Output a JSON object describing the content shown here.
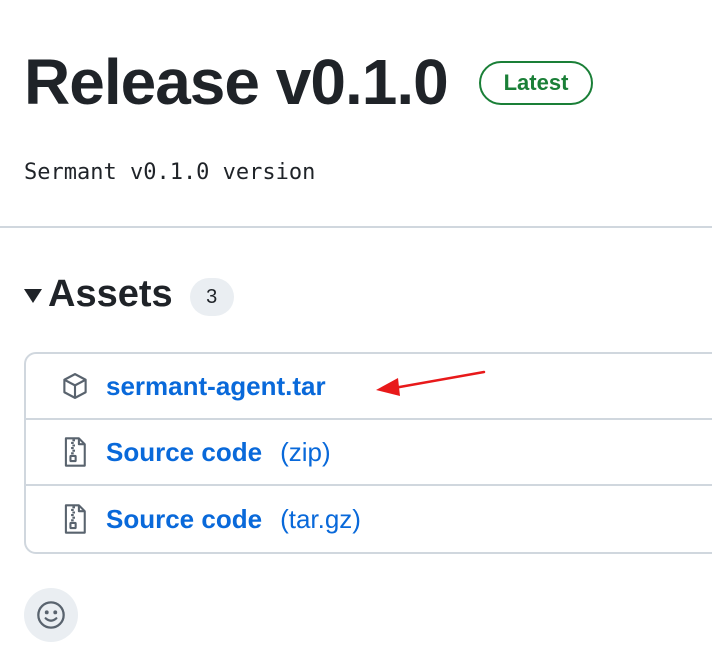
{
  "release": {
    "title": "Release v0.1.0",
    "badge": "Latest",
    "body": "Sermant v0.1.0 version"
  },
  "assets": {
    "title": "Assets",
    "count": "3",
    "items": [
      {
        "icon": "package-icon",
        "label": "sermant-agent.tar",
        "suffix": ""
      },
      {
        "icon": "file-zip-icon",
        "label": "Source code",
        "suffix": "(zip)"
      },
      {
        "icon": "file-zip-icon",
        "label": "Source code",
        "suffix": "(tar.gz)"
      }
    ]
  },
  "reactions": {
    "icon": "smiley-icon"
  },
  "colors": {
    "link": "#0969da",
    "latest": "#1a7f37",
    "annotation": "#e8191a"
  }
}
